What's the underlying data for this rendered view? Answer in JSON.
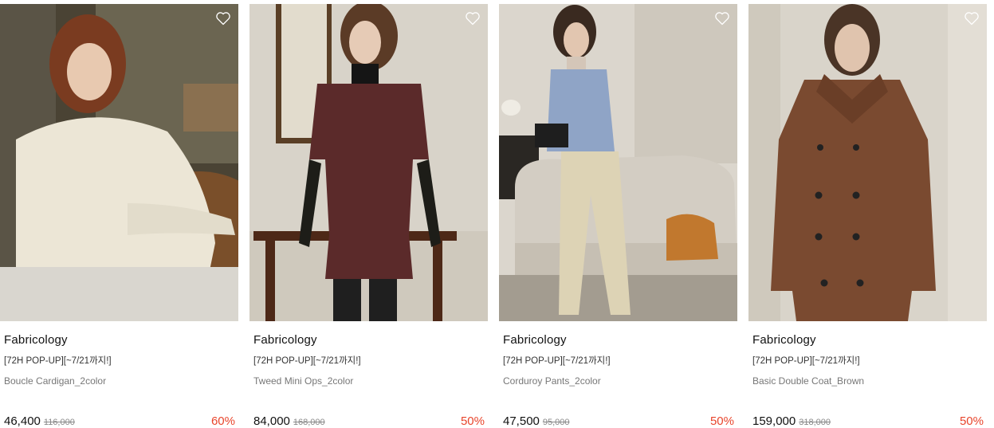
{
  "products": [
    {
      "brand": "Fabricology",
      "tag": "[72H POP-UP][~7/21까지!]",
      "name": "Boucle Cardigan_2color",
      "price": "46,400",
      "original_price": "116,000",
      "discount": "60%",
      "image_icon": "boucle-cardigan-photo",
      "wish_icon": "heart-outline-icon"
    },
    {
      "brand": "Fabricology",
      "tag": "[72H POP-UP][~7/21까지!]",
      "name": "Tweed Mini Ops_2color",
      "price": "84,000",
      "original_price": "168,000",
      "discount": "50%",
      "image_icon": "tweed-dress-photo",
      "wish_icon": "heart-outline-icon"
    },
    {
      "brand": "Fabricology",
      "tag": "[72H POP-UP][~7/21까지!]",
      "name": "Corduroy Pants_2color",
      "price": "47,500",
      "original_price": "95,000",
      "discount": "50%",
      "image_icon": "corduroy-pants-photo",
      "wish_icon": "heart-outline-icon"
    },
    {
      "brand": "Fabricology",
      "tag": "[72H POP-UP][~7/21까지!]",
      "name": "Basic Double Coat_Brown",
      "price": "159,000",
      "original_price": "318,000",
      "discount": "50%",
      "image_icon": "double-coat-photo",
      "wish_icon": "heart-outline-icon"
    }
  ],
  "colors": {
    "discount": "#e8452c",
    "price": "#111111",
    "original_price": "#888888"
  }
}
